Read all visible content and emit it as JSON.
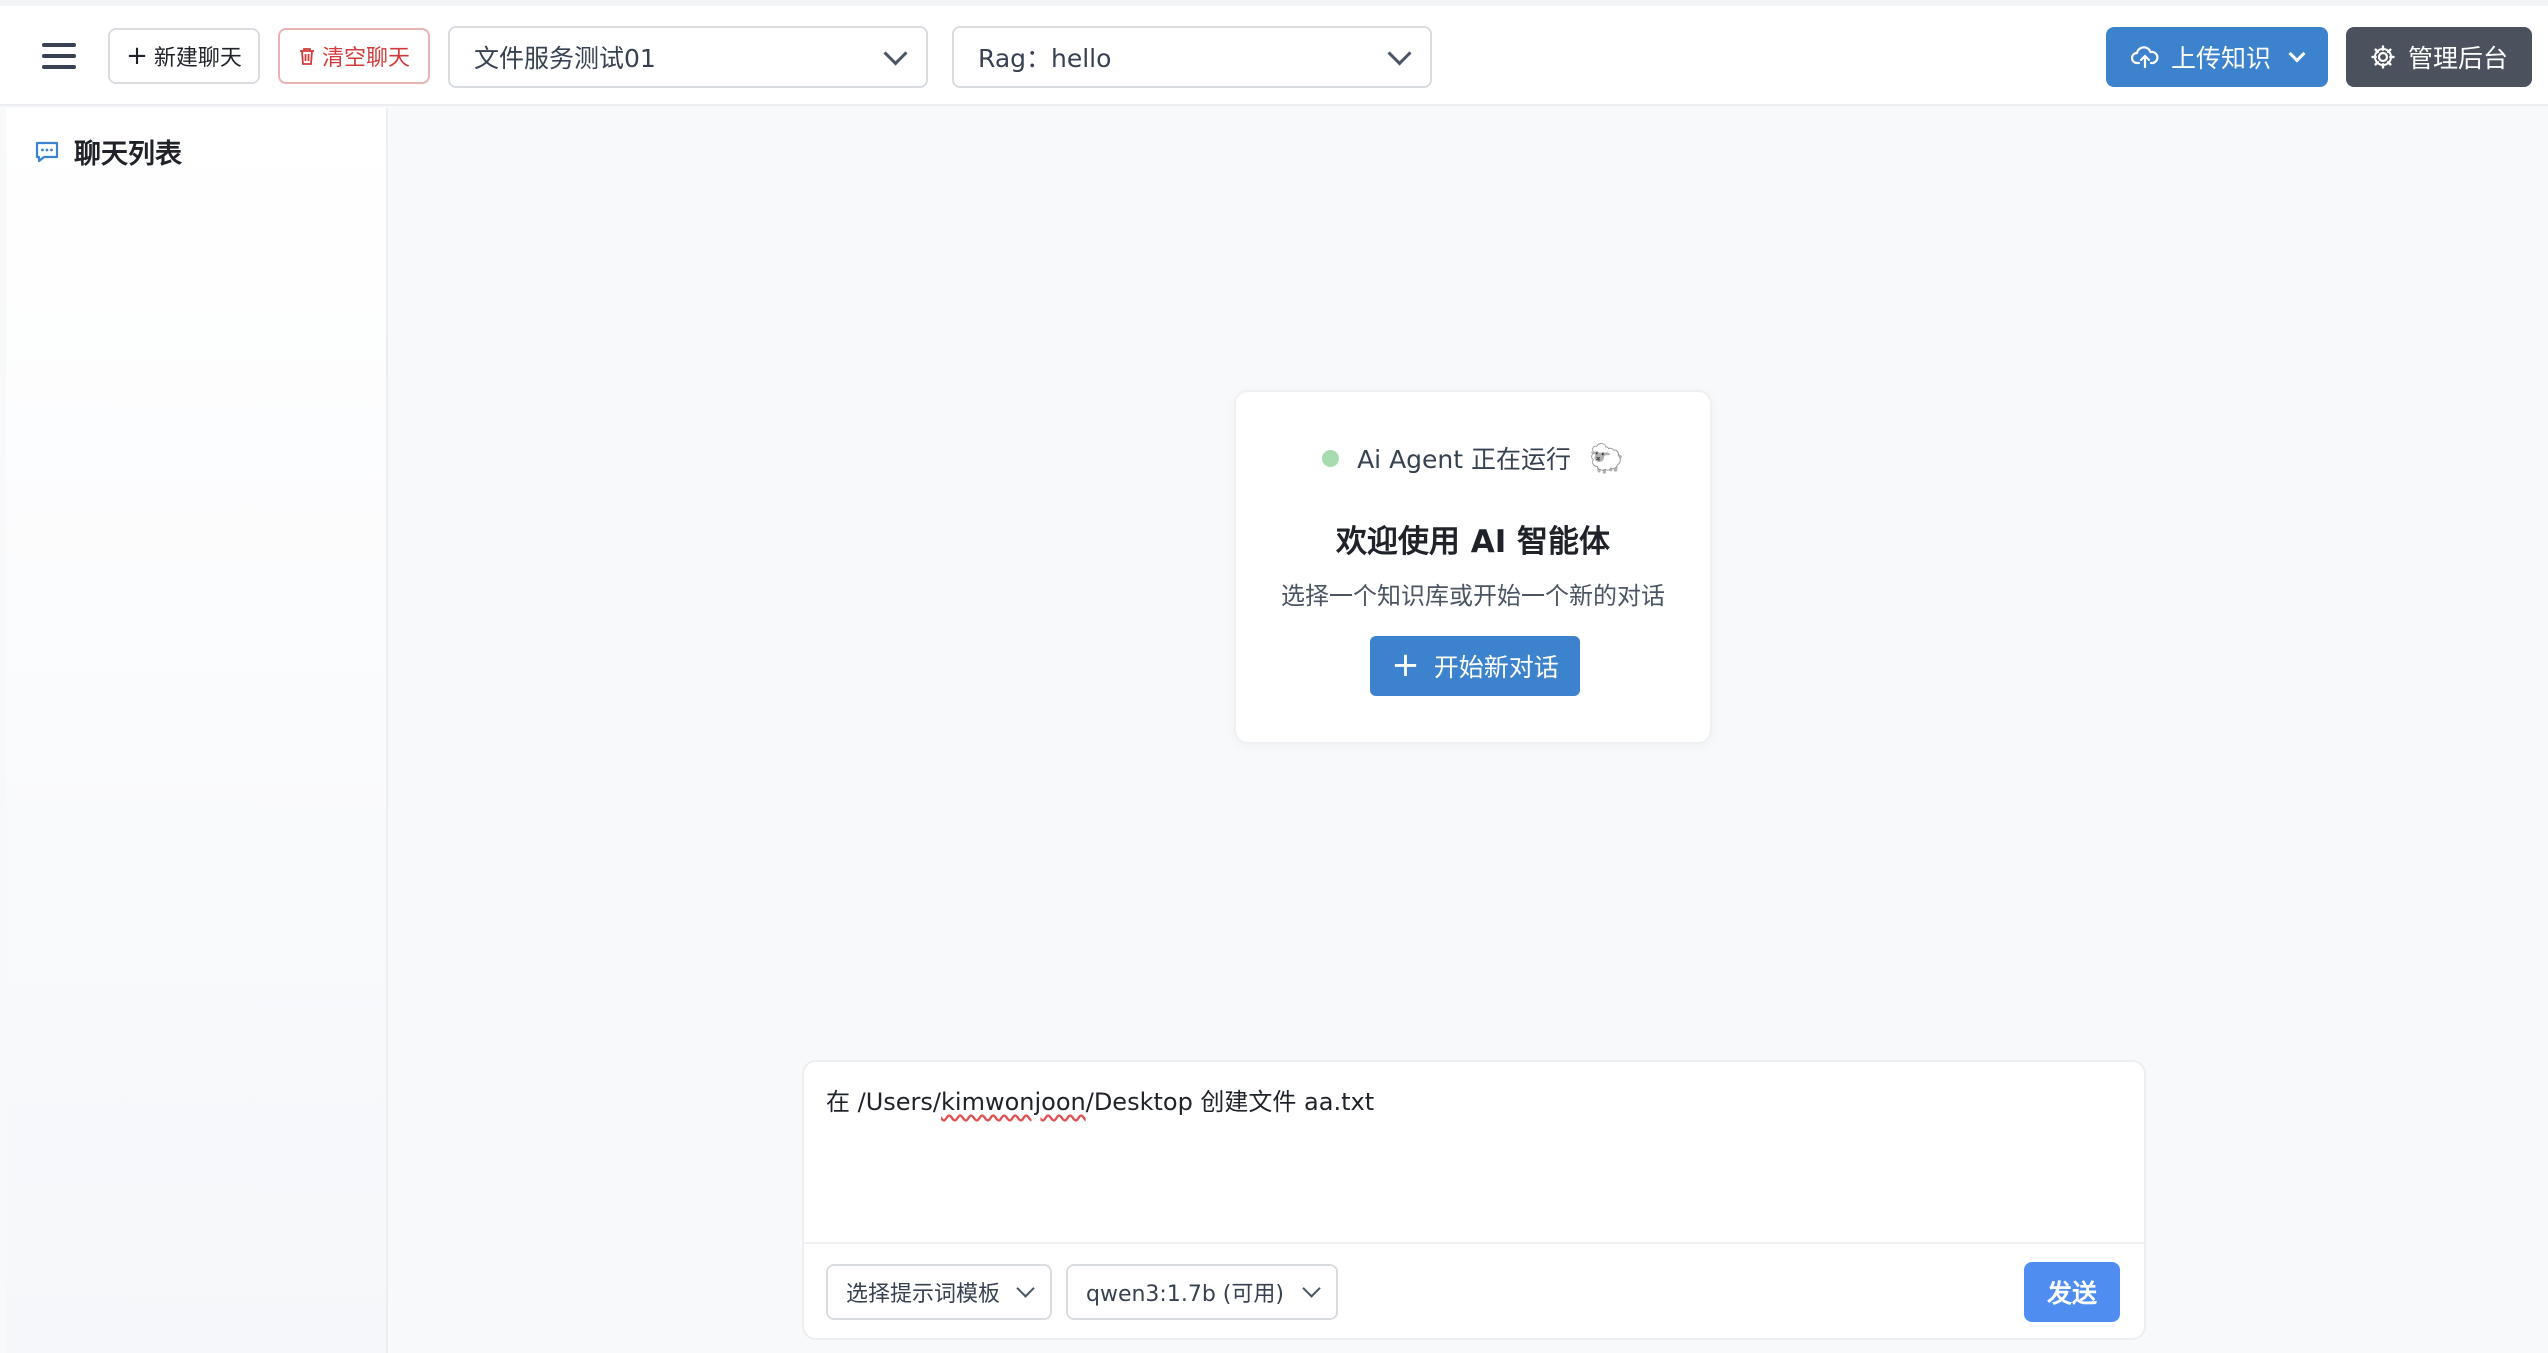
{
  "header": {
    "new_chat_label": "新建聊天",
    "clear_chat_label": "清空聊天",
    "knowledge_base_select": "文件服务测试01",
    "rag_select": "Rag：hello",
    "upload_label": "上传知识",
    "admin_label": "管理后台"
  },
  "sidebar": {
    "title": "聊天列表"
  },
  "welcome": {
    "status": "Ai Agent 正在运行",
    "emoji": "🐑",
    "title": "欢迎使用 AI 智能体",
    "subtitle": "选择一个知识库或开始一个新的对话",
    "start_label": "开始新对话"
  },
  "composer": {
    "text_prefix": "在 /Users/",
    "text_misspelled": "kimwonjoon",
    "text_suffix": "/Desktop 创建文件 aa.txt",
    "prompt_template_select": "选择提示词模板",
    "model_select": "qwen3:1.7b (可用)",
    "send_label": "发送"
  },
  "colors": {
    "primary": "#3c82cc",
    "send": "#4f8ef0",
    "danger": "#d23b3b",
    "admin": "#4b525e",
    "status_dot": "#a8dbb0"
  }
}
